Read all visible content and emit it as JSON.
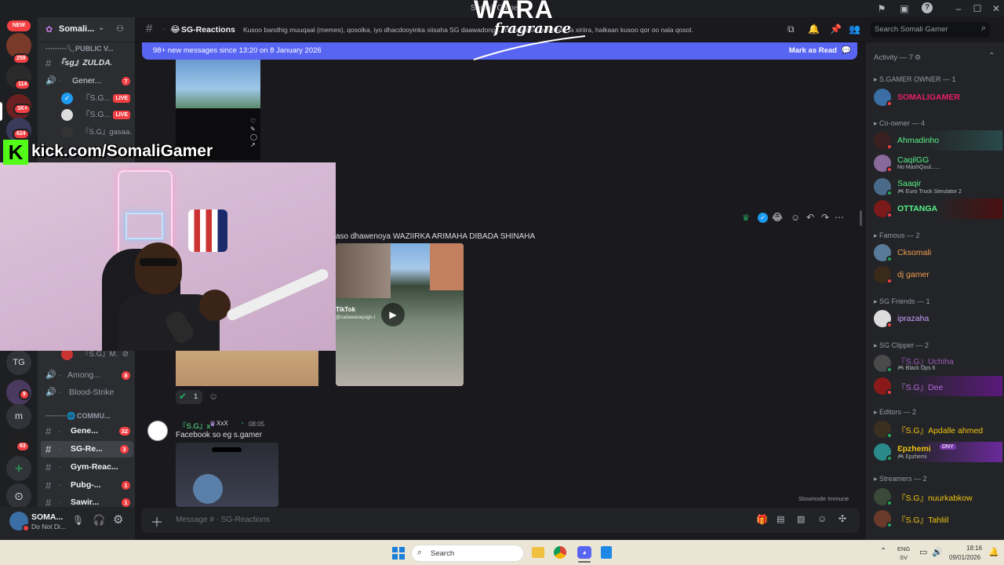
{
  "titlebar": {
    "title": "Somali Gamer"
  },
  "guilds": {
    "new_label": "NEW",
    "badges": [
      "259",
      "114",
      "1K+",
      "624",
      "9",
      "63"
    ],
    "tg_label": "TG",
    "m_label": "m"
  },
  "server": {
    "name": "Somali..."
  },
  "channels": [
    {
      "type": "category",
      "label": "PUBLIC V..."
    },
    {
      "type": "text",
      "label": "『sg』ZULDAA..."
    },
    {
      "type": "voice",
      "label": "Gener...",
      "count": "7"
    },
    {
      "type": "user",
      "label": "『S.G...",
      "live": "LIVE"
    },
    {
      "type": "user",
      "label": "『S.G...",
      "live": "LIVE"
    },
    {
      "type": "user",
      "label": "『S.G』gasaa..."
    },
    {
      "type": "user",
      "label": "『S.G』M..."
    },
    {
      "type": "voice",
      "label": "Among...",
      "count": "8"
    },
    {
      "type": "voice",
      "label": "Blood-Strike"
    },
    {
      "type": "category",
      "label": "COMMU..."
    },
    {
      "type": "text",
      "label": "Gene...",
      "count": "32"
    },
    {
      "type": "text",
      "label": "SG-Re...",
      "count": "3"
    },
    {
      "type": "text",
      "label": "Gym-Reac..."
    },
    {
      "type": "text",
      "label": "Pubg-...",
      "count": "1"
    },
    {
      "type": "text",
      "label": "Sawir...",
      "count": "1"
    }
  ],
  "user_panel": {
    "name": "SOMA...",
    "status": "Do Not Di..."
  },
  "chat_header": {
    "channel": "SG-Reactions",
    "topic": "Kusoo bandhig muuqaal (memes), qosolka, iyo dhacdooyinka xiisaha SG daawadong... muuqaal oo bulshada la xiriira, halkaan kusoo qor oo nala qosol.",
    "search_placeholder": "Search Somali Gamer"
  },
  "new_messages": {
    "text": "98+ new messages since 13:20 on 8 January 2026",
    "action": "Mark as Read"
  },
  "messages": {
    "caption": "aso dhawenoya WAZIIRKA ARIMAHA DIBADA SHINAHA",
    "tiktok": "TikTok",
    "tiktok_user": "@cadawaraqsign-t",
    "reaction_count": "1",
    "msg2_author": "『S.G』x",
    "msg2_tag": "XxX",
    "msg2_time": "08:05",
    "msg2_text": "Facebook so eg s.gamer",
    "slowmode": "Slowmode Immune"
  },
  "composer": {
    "placeholder": "Message # · SG-Reactions"
  },
  "overlay": {
    "kick_text": "kick.com/SomaliGamer",
    "brand_top": "WARA",
    "brand_bottom": "fragrance"
  },
  "members": {
    "activity": "Activity — 7",
    "groups": [
      {
        "label": "S.GAMER OWNER — 1",
        "members": [
          {
            "name": "SOMALIGAMER",
            "color": "#e91e63"
          }
        ]
      },
      {
        "label": "Co-owner — 4",
        "members": [
          {
            "name": "Ahmadinho",
            "color": "#57f287"
          },
          {
            "name": "CaqilGG",
            "color": "#57f287",
            "sub": "No MashQuul......"
          },
          {
            "name": "Saaqir",
            "color": "#57f287",
            "sub": "Euro Truck Simulator 2"
          },
          {
            "name": "OTTANGA",
            "color": "#57f287"
          }
        ]
      },
      {
        "label": "Famous — 2",
        "members": [
          {
            "name": "Cksomali",
            "color": "#f0a050"
          },
          {
            "name": "dj gamer",
            "color": "#f0a050"
          }
        ]
      },
      {
        "label": "SG Friends — 1",
        "members": [
          {
            "name": "iprazaha",
            "color": "#c8a2ff"
          }
        ]
      },
      {
        "label": "SG Clipper — 2",
        "members": [
          {
            "name": "『S.G』Uchiha",
            "color": "#9b59b6",
            "sub": "Black Ops 6"
          },
          {
            "name": "『S.G』Dee",
            "color": "#9b59b6"
          }
        ]
      },
      {
        "label": "Editors — 2",
        "members": [
          {
            "name": "『S.G』Apdalle ahmed",
            "color": "#f1c40f"
          },
          {
            "name": "Ɛpzhemi",
            "color": "#f1c40f",
            "sub": "Ɛpzhemi",
            "tag": "DNY"
          }
        ]
      },
      {
        "label": "Streamers — 2",
        "members": [
          {
            "name": "『S.G』nuurkabkow",
            "color": "#f1c40f"
          },
          {
            "name": "『S.G』Tahliil",
            "color": "#f1c40f"
          }
        ]
      }
    ]
  },
  "taskbar": {
    "search": "Search",
    "lang_top": "ENG",
    "lang_bottom": "SV",
    "time": "18:16",
    "date": "09/01/2026"
  },
  "colors": {
    "accent": "#5865f2",
    "danger": "#f23f43",
    "online": "#23a55a",
    "bg": "#1a1a1e"
  }
}
